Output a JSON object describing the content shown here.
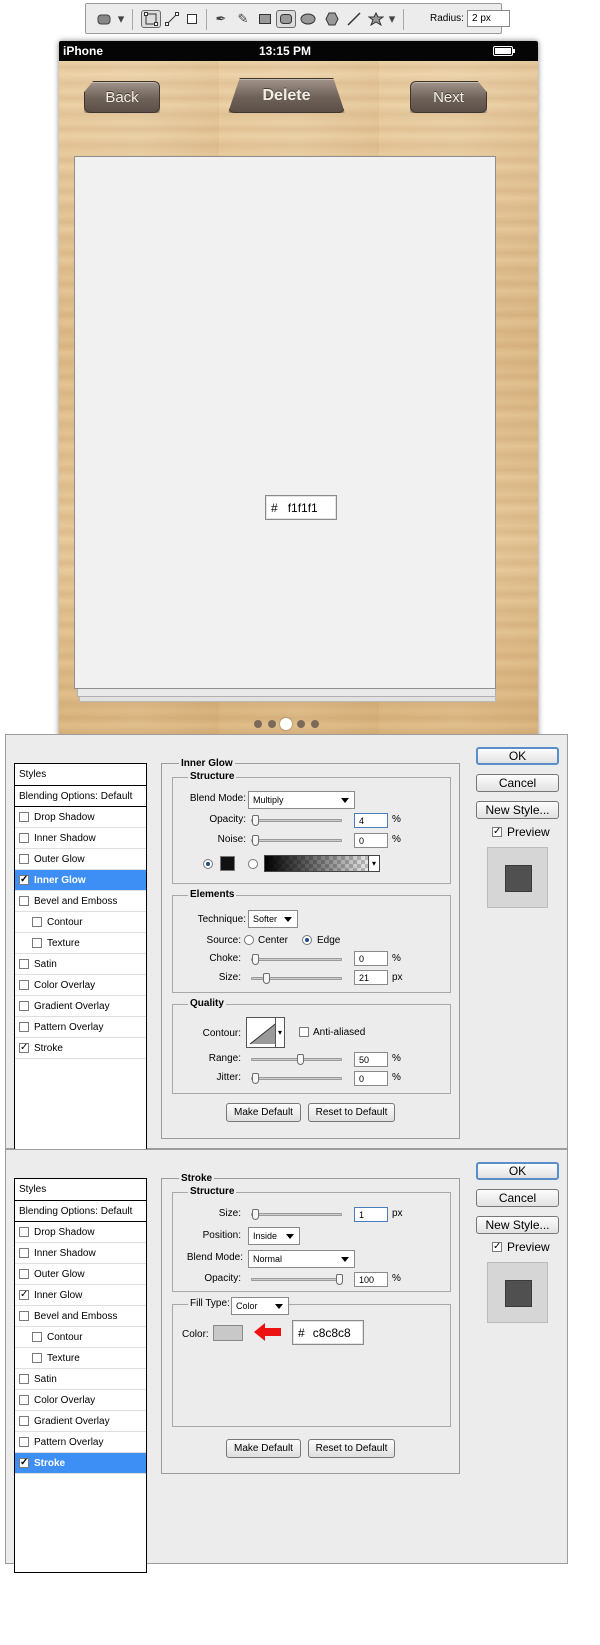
{
  "toolbar": {
    "radius_label": "Radius:",
    "radius_value": "2 px"
  },
  "phone": {
    "carrier": "iPhone",
    "time": "13:15 PM",
    "back_label": "Back",
    "delete_label": "Delete",
    "next_label": "Next",
    "hash": "#",
    "hex_value": "f1f1f1",
    "page_dots": 5,
    "active_dot": 3
  },
  "dialog1": {
    "styles_title": "Styles",
    "blending": "Blending Options: Default",
    "styles": [
      {
        "label": "Drop Shadow",
        "checked": false
      },
      {
        "label": "Inner Shadow",
        "checked": false
      },
      {
        "label": "Outer Glow",
        "checked": false
      },
      {
        "label": "Inner Glow",
        "checked": true
      },
      {
        "label": "Bevel and Emboss",
        "checked": false
      },
      {
        "label": "Contour",
        "checked": false
      },
      {
        "label": "Texture",
        "checked": false
      },
      {
        "label": "Satin",
        "checked": false
      },
      {
        "label": "Color Overlay",
        "checked": false
      },
      {
        "label": "Gradient Overlay",
        "checked": false
      },
      {
        "label": "Pattern Overlay",
        "checked": false
      },
      {
        "label": "Stroke",
        "checked": true
      }
    ],
    "panel_title": "Inner Glow",
    "structure": "Structure",
    "blend_mode_label": "Blend Mode:",
    "blend_mode": "Multiply",
    "opacity_label": "Opacity:",
    "opacity": "4",
    "noise_label": "Noise:",
    "noise": "0",
    "elements": "Elements",
    "technique_label": "Technique:",
    "technique": "Softer",
    "source_label": "Source:",
    "center": "Center",
    "edge": "Edge",
    "choke_label": "Choke:",
    "choke": "0",
    "size_label": "Size:",
    "size": "21",
    "quality": "Quality",
    "contour_label": "Contour:",
    "anti_aliased": "Anti-aliased",
    "range_label": "Range:",
    "range": "50",
    "jitter_label": "Jitter:",
    "jitter": "0",
    "pct": "%",
    "px": "px",
    "make_default": "Make Default",
    "reset_default": "Reset to Default",
    "ok": "OK",
    "cancel": "Cancel",
    "new_style": "New Style...",
    "preview": "Preview"
  },
  "dialog2": {
    "styles_title": "Styles",
    "blending": "Blending Options: Default",
    "styles": [
      {
        "label": "Drop Shadow",
        "checked": false
      },
      {
        "label": "Inner Shadow",
        "checked": false
      },
      {
        "label": "Outer Glow",
        "checked": false
      },
      {
        "label": "Inner Glow",
        "checked": true
      },
      {
        "label": "Bevel and Emboss",
        "checked": false
      },
      {
        "label": "Contour",
        "checked": false
      },
      {
        "label": "Texture",
        "checked": false
      },
      {
        "label": "Satin",
        "checked": false
      },
      {
        "label": "Color Overlay",
        "checked": false
      },
      {
        "label": "Gradient Overlay",
        "checked": false
      },
      {
        "label": "Pattern Overlay",
        "checked": false
      },
      {
        "label": "Stroke",
        "checked": true
      }
    ],
    "panel_title": "Stroke",
    "structure": "Structure",
    "size_label": "Size:",
    "size": "1",
    "px": "px",
    "position_label": "Position:",
    "position": "Inside",
    "blend_mode_label": "Blend Mode:",
    "blend_mode": "Normal",
    "opacity_label": "Opacity:",
    "opacity": "100",
    "pct": "%",
    "fill_type_label": "Fill Type:",
    "fill_type": "Color",
    "color_label": "Color:",
    "hash": "#",
    "hex_value": "c8c8c8",
    "swatch_color": "#c8c8c8",
    "make_default": "Make Default",
    "reset_default": "Reset to Default",
    "ok": "OK",
    "cancel": "Cancel",
    "new_style": "New Style...",
    "preview": "Preview"
  }
}
